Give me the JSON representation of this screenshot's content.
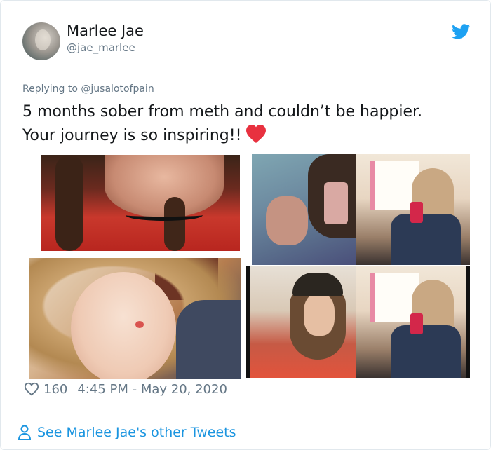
{
  "author": {
    "name": "Marlee Jae",
    "handle": "@jae_marlee"
  },
  "icons": {
    "brand": "twitter-bird-icon",
    "brand_color": "#1da1f2",
    "like": "heart-outline-icon",
    "profile": "person-icon",
    "emoji": "red-heart-emoji"
  },
  "reply": {
    "prefix": "Replying to",
    "mention": "@jusalotofpain"
  },
  "tweet": {
    "line1": "5 months sober from meth and couldn’t be happier.",
    "line2": "Your journey is so inspiring!!"
  },
  "meta": {
    "likes": "160",
    "timestamp": "4:45 PM - May 20, 2020"
  },
  "footer": {
    "link": "See Marlee Jae's other Tweets"
  },
  "colors": {
    "text": "#14171a",
    "secondary": "#657786",
    "link": "#1b95e0",
    "border": "#e1e8ed"
  }
}
